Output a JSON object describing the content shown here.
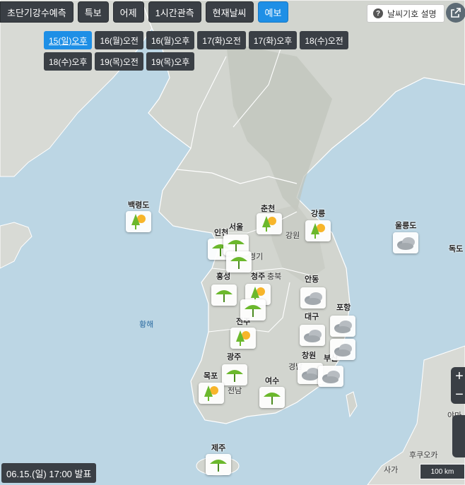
{
  "tabs": [
    "초단기강수예측",
    "특보",
    "어제",
    "1시간관측",
    "현재날씨",
    "예보"
  ],
  "active_tab": 5,
  "times": [
    "15(일)오후",
    "16(월)오전",
    "16(월)오후",
    "17(화)오전",
    "17(화)오후",
    "18(수)오전",
    "18(수)오후",
    "19(목)오전",
    "19(목)오후"
  ],
  "active_time": 0,
  "help": {
    "icon": "?",
    "label": "날씨기호 설명"
  },
  "zoom": {
    "plus": "+",
    "minus": "−"
  },
  "stamp": "06.15.(일) 17:00 발표",
  "scale_label": "100 km",
  "sea_label": "황해",
  "cities": [
    "백령도",
    "서울",
    "인천",
    "춘천",
    "강릉",
    "강원",
    "울릉도",
    "독도",
    "경기",
    "홍성",
    "청주",
    "충북",
    "안동",
    "대구",
    "포항",
    "전주",
    "광주",
    "목포",
    "창원",
    "부산",
    "경남",
    "여수",
    "전남",
    "제주",
    "후쿠오카",
    "사가",
    "야마"
  ],
  "icons": {
    "sun-rain": "partly-sunny-rain",
    "umbrella": "rain-umbrella",
    "cloudy": "cloudy"
  },
  "colors": {
    "accent": "#1e8fe6",
    "button": "#3a3f45",
    "sea": "#bcd6e4",
    "land": "#d7d9d4"
  }
}
